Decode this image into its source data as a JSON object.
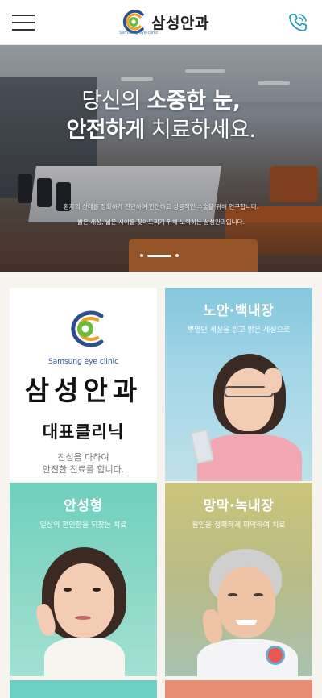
{
  "header": {
    "brand_name": "삼성안과",
    "brand_sub": "Samsung eye clinic",
    "menu_icon": "hamburger-menu-icon",
    "call_icon": "phone-call-icon"
  },
  "hero": {
    "title_line1_light": "당신의 ",
    "title_line1_bold": "소중한 눈,",
    "title_line2_bold": "안전하게",
    "title_line2_light": " 치료하세요.",
    "desc1": "환자의 상태를 정확하게 진단하여 안전하고 성공적인 수술을 위해 연구합니다.",
    "desc2": "밝은 세상, 넓은 시야를 찾아드리기 위해 노력하는 삼성안과입니다."
  },
  "intro": {
    "eng_name": "Samsung eye clinic",
    "name": "삼성안과",
    "subtitle": "대표클리닉",
    "line1": "진심을 다하여",
    "line2": "안전한 진료를 합니다."
  },
  "cards": [
    {
      "title": "노안·백내장",
      "desc": "뿌옇던 세상을 맑고 밝은 세상으로"
    },
    {
      "title": "안성형",
      "desc": "일상의 편안함을 되찾는 치료"
    },
    {
      "title": "망막·녹내장",
      "desc": "원인을 정확하게 파악하여 치료"
    }
  ],
  "colors": {
    "brand_blue": "#2d4f8b",
    "brand_green": "#6dbb3a",
    "brand_orange": "#f0a020",
    "teal": "#3cc2b2"
  }
}
